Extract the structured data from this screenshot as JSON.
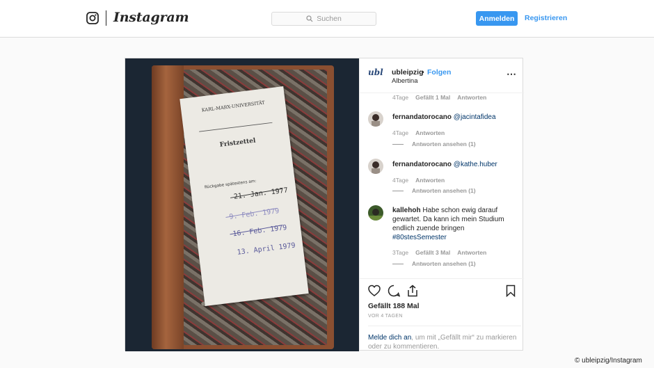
{
  "header": {
    "wordmark": "Instagram",
    "search_placeholder": "Suchen",
    "login_label": "Anmelden",
    "register_label": "Registrieren"
  },
  "post": {
    "account": "ubleipzig",
    "avatar_text": "ubl",
    "separator": "•",
    "follow_label": "Folgen",
    "location": "Albertina",
    "more_icon": "⋯",
    "photo_alt_text": {
      "slip_header": "KARL-MARX-UNIVERSITÄT",
      "slip_title": "Fristzettel",
      "slip_label": "Rückgabe spätestens am:",
      "dates": [
        "21. Jan. 1977",
        "9. Feb. 1979",
        "16. Feb. 1979",
        "13. April 1979"
      ]
    },
    "top_meta": {
      "age": "4Tage",
      "likes": "Gefällt 1 Mal",
      "reply": "Antworten"
    },
    "comments": [
      {
        "user": "fernandatorocano",
        "text": "@jacintafidea",
        "age": "4Tage",
        "reply": "Antworten",
        "view_replies": "Antworten ansehen (1)"
      },
      {
        "user": "fernandatorocano",
        "text": "@kathe.huber",
        "age": "4Tage",
        "reply": "Antworten",
        "view_replies": "Antworten ansehen (1)"
      },
      {
        "user": "kallehoh",
        "text_lines": [
          "Habe schon ewig darauf",
          "gewartet. Da kann ich mein Studium",
          "endlich zuende bringen"
        ],
        "hashtag": "#80stesSemester",
        "age": "3Tage",
        "likes": "Gefällt 3 Mal",
        "reply": "Antworten",
        "view_replies": "Antworten ansehen (1)"
      }
    ],
    "likes_count": "Gefällt 188 Mal",
    "time_ago": "VOR 4 TAGEN",
    "login_link": "Melde dich an",
    "login_rest": ", um mit „Gefällt mir“ zu markieren oder zu kommentieren."
  },
  "credit": "© ubleipzig/Instagram",
  "colors": {
    "accent": "#3897f0",
    "link": "#003569",
    "muted": "#999999"
  }
}
